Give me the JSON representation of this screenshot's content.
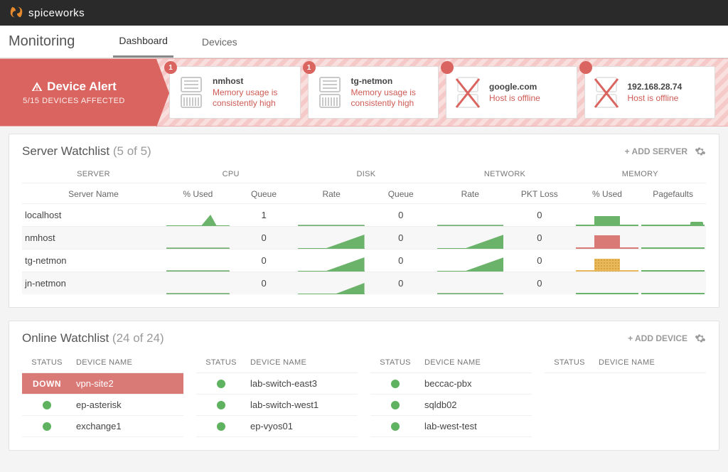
{
  "brand": "spiceworks",
  "page_title": "Monitoring",
  "tabs": {
    "dashboard": "Dashboard",
    "devices": "Devices"
  },
  "alert": {
    "title": "Device Alert",
    "subtitle": "5/15 DEVICES AFFECTED",
    "cards": [
      {
        "badge": "1",
        "name": "nmhost",
        "msg": "Memory usage is consistently high",
        "offline": false
      },
      {
        "badge": "1",
        "name": "tg-netmon",
        "msg": "Memory usage is consistently high",
        "offline": false
      },
      {
        "badge": "!",
        "name": "google.com",
        "msg": "Host is offline",
        "offline": true
      },
      {
        "badge": "!",
        "name": "192.168.28.74",
        "msg": "Host is offline",
        "offline": true
      }
    ]
  },
  "server_watchlist": {
    "title_prefix": "Server Watchlist",
    "count": "(5 of 5)",
    "add_label": "+ ADD SERVER",
    "groups": {
      "server": "SERVER",
      "cpu": "CPU",
      "disk": "DISK",
      "network": "NETWORK",
      "memory": "MEMORY"
    },
    "subheaders": {
      "server_name": "Server Name",
      "pct_used": "% Used",
      "queue": "Queue",
      "rate": "Rate",
      "pkt_loss": "PKT Loss",
      "pagefaults": "Pagefaults"
    },
    "rows": [
      {
        "name": "localhost",
        "cpu_queue": "1",
        "disk_queue": "0",
        "net_pktloss": "0",
        "mem_level": "green",
        "mem_pct": 62,
        "cpu_shape": "bump",
        "disk_shape": "flat",
        "net_shape": "flat",
        "pf_shape": "bump"
      },
      {
        "name": "nmhost",
        "cpu_queue": "0",
        "disk_queue": "0",
        "net_pktloss": "0",
        "mem_level": "red",
        "mem_pct": 86,
        "cpu_shape": "flat",
        "disk_shape": "ramp",
        "net_shape": "ramp",
        "pf_shape": "flat"
      },
      {
        "name": "tg-netmon",
        "cpu_queue": "0",
        "disk_queue": "0",
        "net_pktloss": "0",
        "mem_level": "amber",
        "mem_pct": 80,
        "cpu_shape": "flat",
        "disk_shape": "ramp",
        "net_shape": "ramp",
        "pf_shape": "flat"
      },
      {
        "name": "jn-netmon",
        "cpu_queue": "0",
        "disk_queue": "0",
        "net_pktloss": "0",
        "mem_level": "green",
        "mem_pct": 0,
        "cpu_shape": "flat",
        "disk_shape": "halframp",
        "net_shape": "flat",
        "pf_shape": "flat",
        "mem_underline_only": true
      }
    ]
  },
  "online_watchlist": {
    "title_prefix": "Online Watchlist",
    "count": "(24 of 24)",
    "add_label": "+ ADD DEVICE",
    "headers": {
      "status": "STATUS",
      "device_name": "DEVICE NAME"
    },
    "down_label": "DOWN",
    "columns": [
      [
        {
          "status": "down",
          "name": "vpn-site2"
        },
        {
          "status": "up",
          "name": "ep-asterisk"
        },
        {
          "status": "up",
          "name": "exchange1"
        }
      ],
      [
        {
          "status": "up",
          "name": "lab-switch-east3"
        },
        {
          "status": "up",
          "name": "lab-switch-west1"
        },
        {
          "status": "up",
          "name": "ep-vyos01"
        }
      ],
      [
        {
          "status": "up",
          "name": "beccac-pbx"
        },
        {
          "status": "up",
          "name": "sqldb02"
        },
        {
          "status": "up",
          "name": "lab-west-test"
        }
      ],
      []
    ]
  },
  "chart_data": {
    "type": "table",
    "title": "Server Watchlist (5 of 5)",
    "columns": [
      "Server Name",
      "CPU % Used (trend)",
      "CPU Queue",
      "Disk Rate (trend)",
      "Disk Queue",
      "Network Rate (trend)",
      "Network PKT Loss",
      "Memory % Used",
      "Pagefaults (trend)"
    ],
    "rows": [
      [
        "localhost",
        "spike",
        1,
        "flat",
        0,
        "flat",
        0,
        62,
        "small spike"
      ],
      [
        "nmhost",
        "flat",
        0,
        "rising",
        0,
        "rising",
        0,
        86,
        "flat"
      ],
      [
        "tg-netmon",
        "flat",
        0,
        "rising",
        0,
        "rising",
        0,
        80,
        "flat"
      ],
      [
        "jn-netmon",
        "flat",
        0,
        "partial rising",
        0,
        "flat",
        0,
        0,
        "flat"
      ]
    ]
  }
}
